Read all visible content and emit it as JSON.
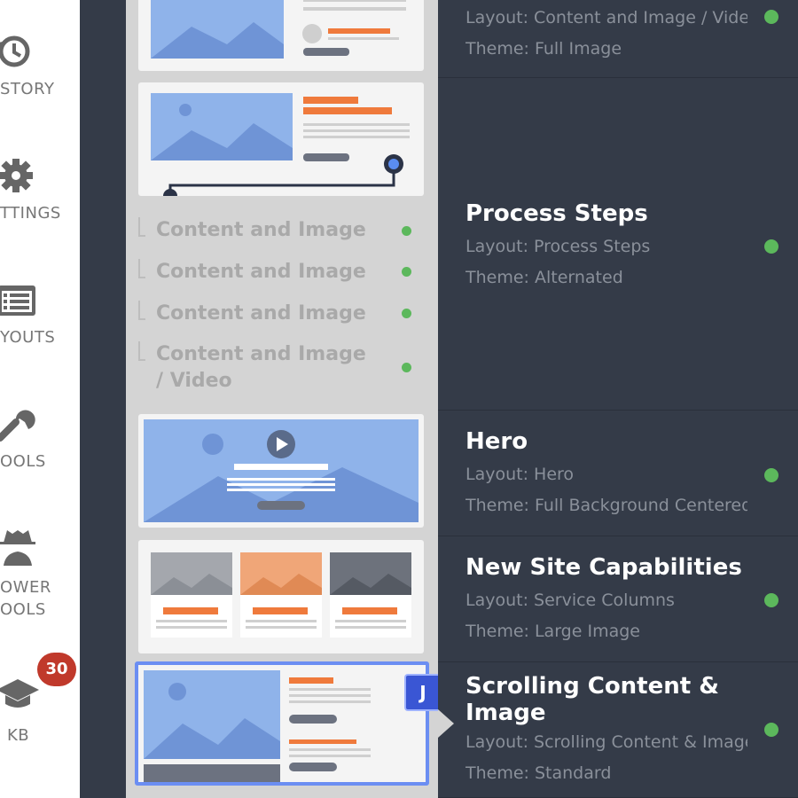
{
  "sidebar": {
    "items": [
      {
        "label": "STORY",
        "icon": "history-icon"
      },
      {
        "label": "TTINGS",
        "icon": "gear-icon"
      },
      {
        "label": "YOUTS",
        "icon": "layouts-icon"
      },
      {
        "label": "OOLS",
        "icon": "wrench-icon"
      },
      {
        "label_line1": "OWER",
        "label_line2": "OOLS",
        "icon": "spy-icon"
      },
      {
        "label": "KB",
        "icon": "graduation-cap-icon"
      }
    ],
    "kb_badge": "30"
  },
  "panel": {
    "sub_items": [
      "Content and Image",
      "Content and Image",
      "Content and Image",
      "Content and Image / Video"
    ],
    "selected_badge": "J"
  },
  "list": {
    "rows": [
      {
        "title": "",
        "layout": "Layout: Content and Image / Video",
        "theme": "Theme: Full Image"
      },
      {
        "title": "Process Steps",
        "layout": "Layout: Process Steps",
        "theme": "Theme: Alternated"
      },
      {
        "title": "Hero",
        "layout": "Layout: Hero",
        "theme": "Theme: Full Background Centered"
      },
      {
        "title": "New Site Capabilities",
        "layout": "Layout: Service Columns",
        "theme": "Theme: Large Image"
      },
      {
        "title": "Scrolling Content & Image",
        "layout": "Layout: Scrolling Content & Image",
        "theme": "Theme: Standard"
      }
    ]
  },
  "colors": {
    "status_dot": "#5cb85c",
    "accent_orange": "#ef7a3c",
    "selection_blue": "#6b8ef2",
    "badge_red": "#c0392b"
  }
}
